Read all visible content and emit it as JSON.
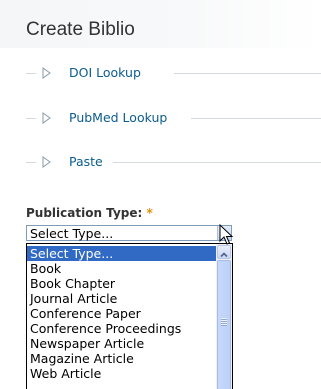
{
  "page": {
    "title": "Create Biblio"
  },
  "lookups": [
    {
      "label": "DOI Lookup"
    },
    {
      "label": "PubMed Lookup"
    },
    {
      "label": "Paste"
    }
  ],
  "publication_type": {
    "label": "Publication Type:",
    "required_marker": "*",
    "selected_value": "Select Type...",
    "options": [
      "Select Type...",
      "Book",
      "Book Chapter",
      "Journal Article",
      "Conference Paper",
      "Conference Proceedings",
      "Newspaper Article",
      "Magazine Article",
      "Web Article"
    ]
  },
  "colors": {
    "link": "#0c5c8f",
    "required": "#e09010",
    "selection": "#316ac5"
  },
  "icons": {
    "legend_arrow": "triangle-right-outline-icon",
    "select_button": "chevron-down-icon",
    "scroll_up": "chevron-up-icon",
    "cursor": "mouse-pointer-icon"
  }
}
